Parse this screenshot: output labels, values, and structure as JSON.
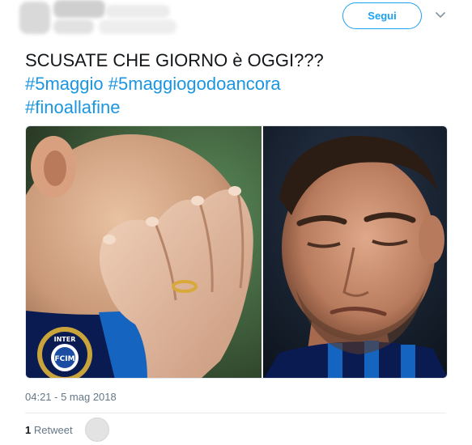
{
  "header": {
    "follow_label": "Segui"
  },
  "tweet": {
    "lines": [
      {
        "text": "SCUSATE CHE GIORNO è OGGI???"
      },
      {
        "hashtags": [
          "#5maggio",
          "#5maggiogodoancora"
        ]
      },
      {
        "hashtags": [
          "#fino alla fine"
        ]
      }
    ],
    "line1": "SCUSATE CHE GIORNO è OGGI???",
    "hashtag1": "#5maggio",
    "hashtag2": "#5maggiogodoancora",
    "hashtag3": "#finoallafine"
  },
  "meta": {
    "timestamp": "04:21 - 5 mag 2018",
    "retweet_count": "1",
    "retweet_label": "Retweet"
  },
  "media": {
    "badge_text": "INTER",
    "badge_monogram": "FCIM"
  },
  "colors": {
    "link": "#1b95e0",
    "follow_border": "#1da1f2",
    "muted": "#657786"
  }
}
